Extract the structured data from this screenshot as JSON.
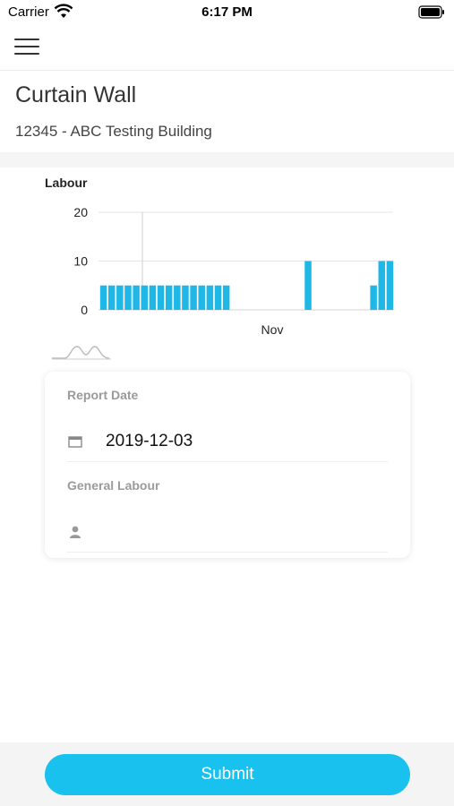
{
  "status_bar": {
    "carrier": "Carrier",
    "time": "6:17 PM"
  },
  "header": {
    "title": "Curtain Wall",
    "subtitle": "12345 - ABC Testing Building"
  },
  "colors": {
    "accent": "#18c1ee",
    "bar": "#1fb8e6"
  },
  "chart_data": {
    "type": "bar",
    "title": "Labour",
    "x_tick_labels": [
      "Nov"
    ],
    "y_ticks": [
      0,
      10,
      20
    ],
    "ylim": [
      0,
      20
    ],
    "grid": true,
    "values": [
      5,
      5,
      5,
      5,
      5,
      5,
      5,
      5,
      5,
      5,
      5,
      5,
      5,
      5,
      5,
      5,
      0,
      0,
      0,
      0,
      0,
      0,
      0,
      0,
      0,
      10,
      0,
      0,
      0,
      0,
      0,
      0,
      0,
      5,
      10,
      10
    ]
  },
  "form": {
    "report_date_label": "Report Date",
    "report_date_value": "2019-12-03",
    "general_labour_label": "General Labour",
    "general_labour_value": ""
  },
  "icons": {
    "menu": "hamburger-menu-icon",
    "calendar": "calendar-icon",
    "person": "person-icon",
    "mini_chart": "mini-chart-icon"
  },
  "submit": {
    "label": "Submit"
  }
}
